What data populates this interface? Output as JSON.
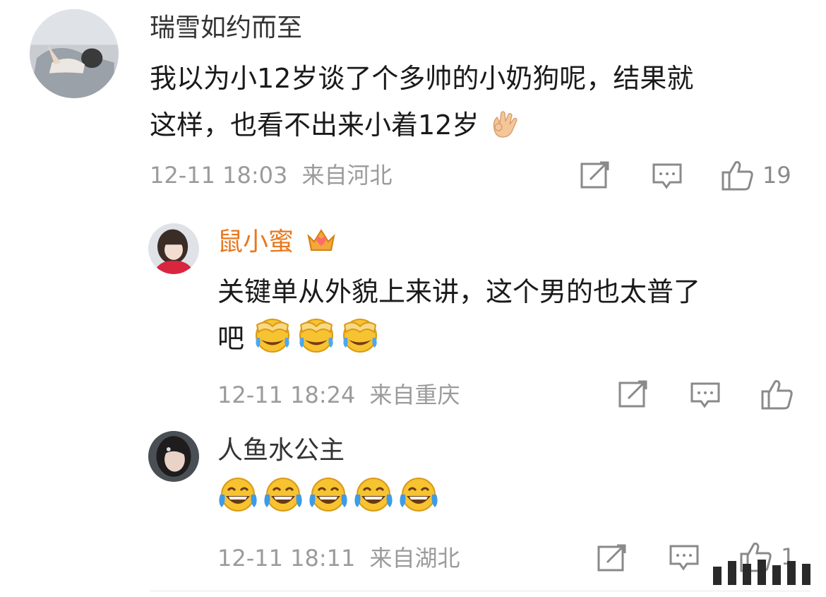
{
  "comment": {
    "user": "瑞雪如约而至",
    "text_line1": "我以为小12岁谈了个多帅的小奶狗呢，结果就",
    "text_line2": "这样，也看不出来小着12岁",
    "emoji_icon": "ok-hand-icon",
    "time": "12-11 18:03",
    "location": "来自河北",
    "likes": "19"
  },
  "replies": [
    {
      "user": "鼠小蜜",
      "user_color": "#e8781e",
      "badge_icon": "crown-badge-icon",
      "text_line1": "关键单从外貌上来讲，这个男的也太普了",
      "text_line2": "吧",
      "emoji_icon": "facepalm-laugh-icon",
      "time": "12-11 18:24",
      "location": "来自重庆"
    },
    {
      "user": "人鱼水公主",
      "emoji_icon": "tears-of-joy-icon",
      "time": "12-11 18:11",
      "location": "来自湖北",
      "likes": "1"
    }
  ],
  "icons": {
    "share": "share-icon",
    "comment": "comment-icon",
    "like": "like-icon"
  },
  "colors": {
    "meta_text": "#9b9b9b",
    "accent_name": "#e8781e",
    "emoji_yellow": "#f7c331"
  }
}
